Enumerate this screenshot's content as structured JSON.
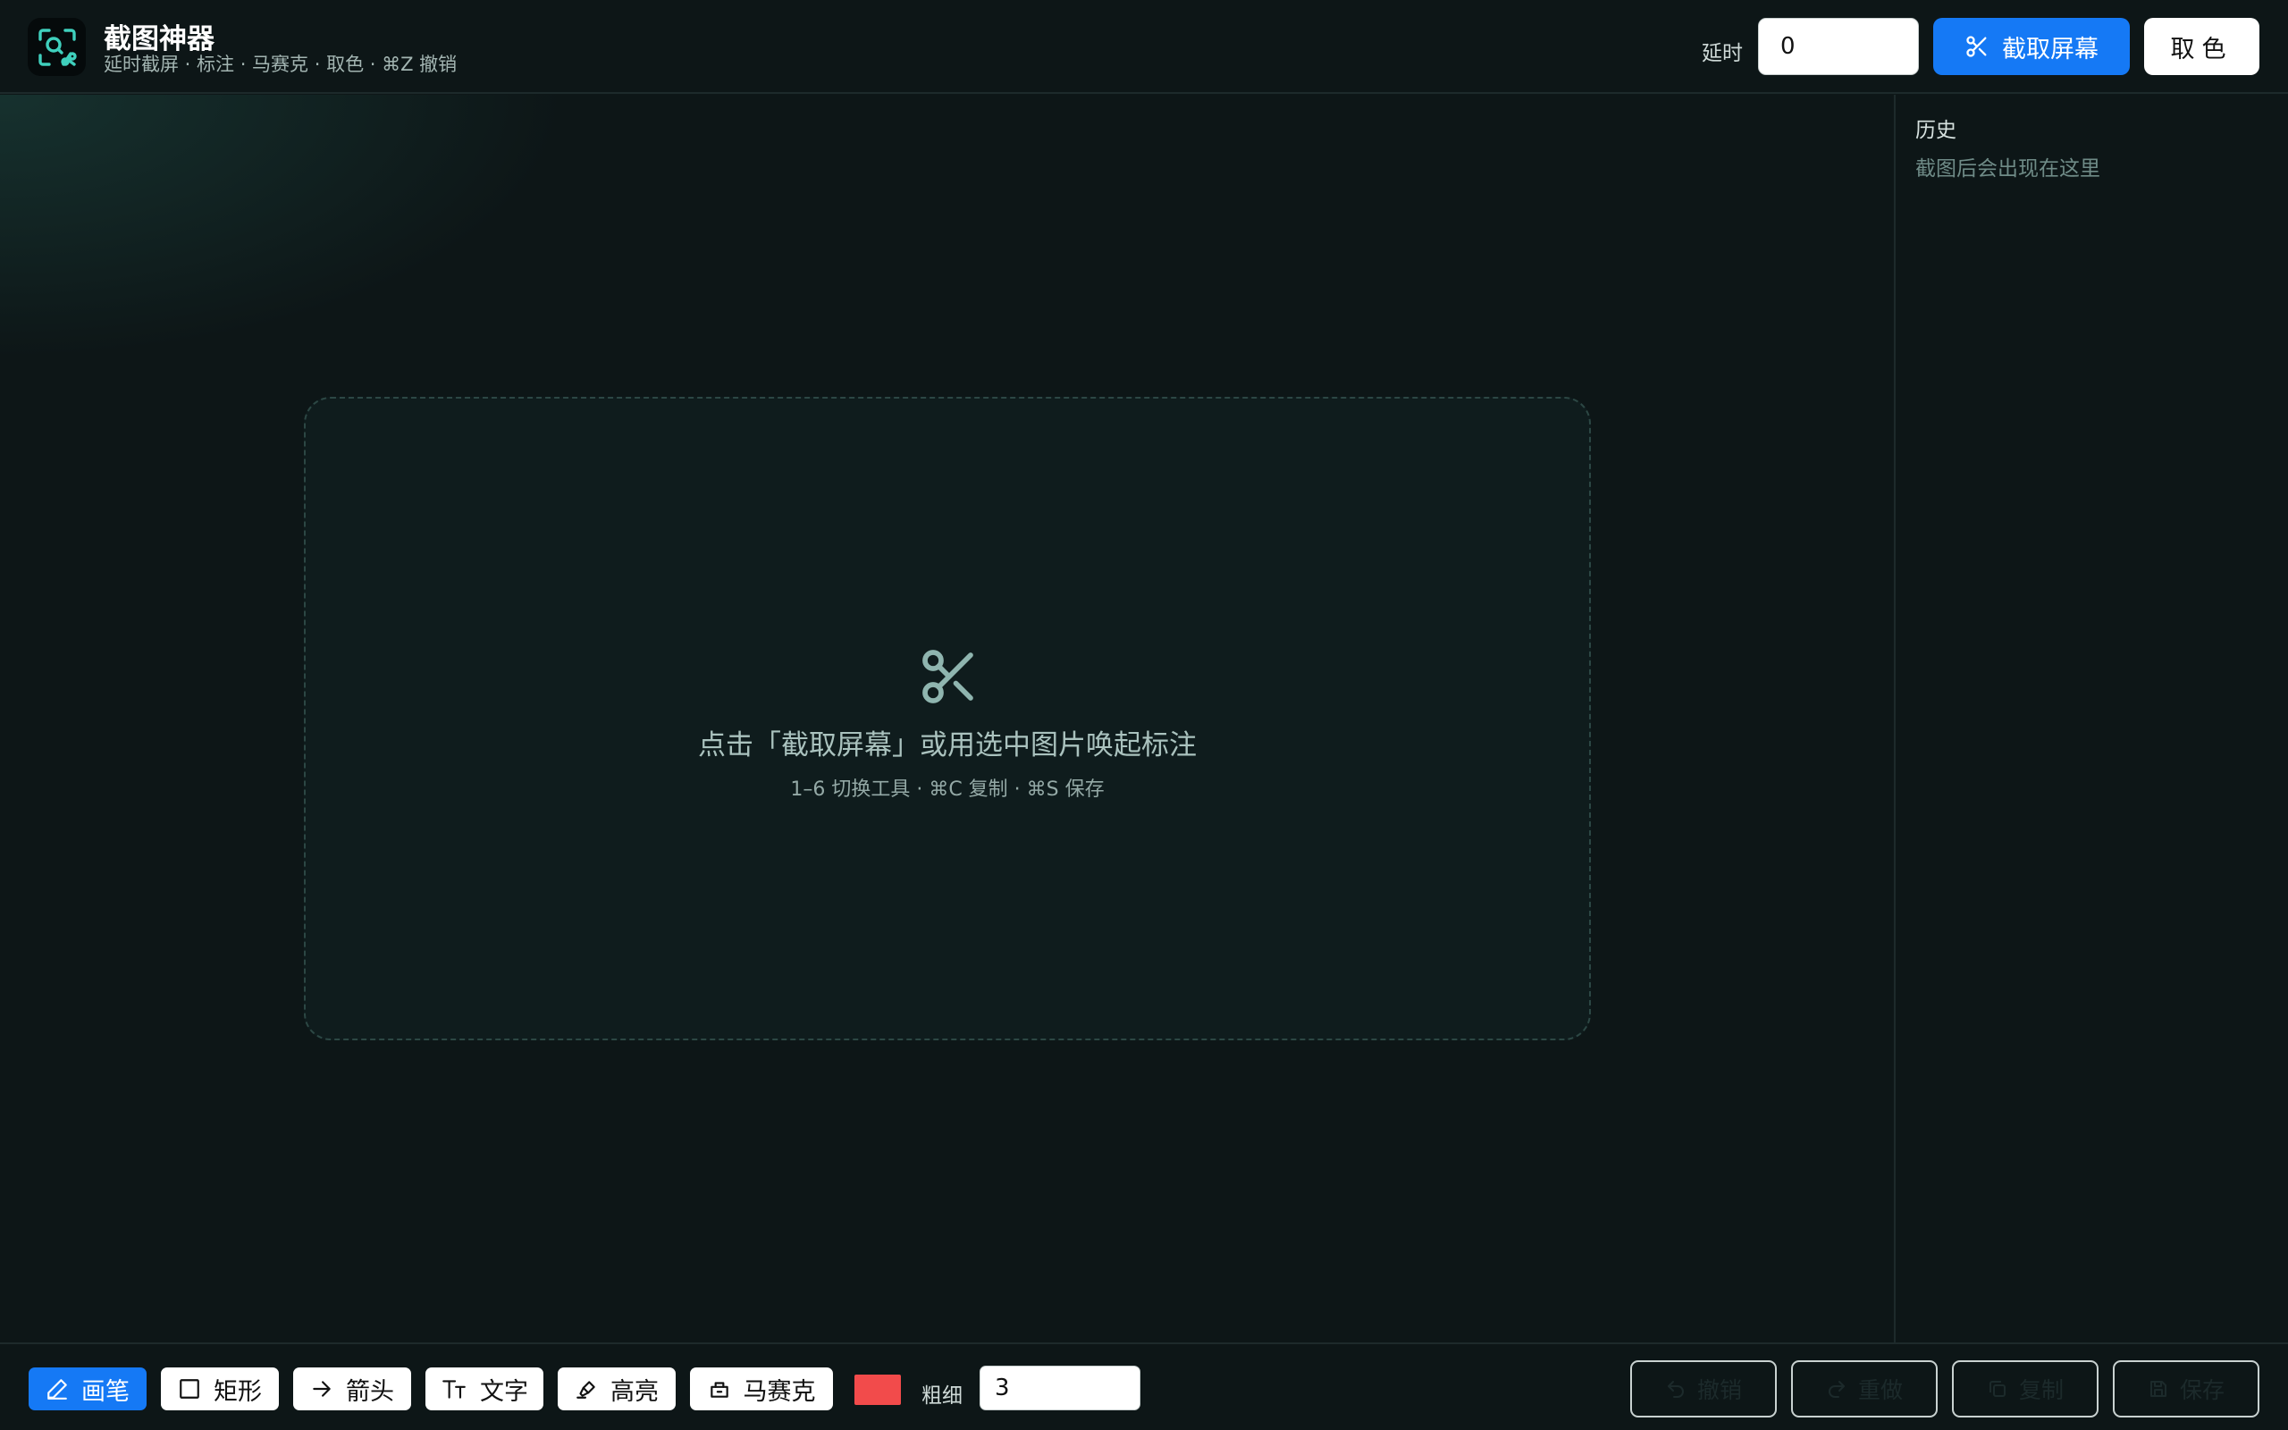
{
  "header": {
    "title": "截图神器",
    "subtitle": "延时截屏 · 标注 · 马赛克 · 取色 · ⌘Z 撤销",
    "delay_label": "延时",
    "delay_value": "0",
    "capture_label": "截取屏幕",
    "pick_color_label": "取色"
  },
  "canvas": {
    "empty_title": "点击「截取屏幕」或用选中图片唤起标注",
    "empty_hint": "1–6 切换工具 · ⌘C 复制 · ⌘S 保存"
  },
  "history": {
    "title": "历史",
    "empty_text": "截图后会出现在这里"
  },
  "toolbar": {
    "tools": [
      {
        "label": "画笔",
        "icon": "pen-icon",
        "active": true
      },
      {
        "label": "矩形",
        "icon": "rectangle-icon",
        "active": false
      },
      {
        "label": "箭头",
        "icon": "arrow-icon",
        "active": false
      },
      {
        "label": "文字",
        "icon": "text-icon",
        "active": false
      },
      {
        "label": "高亮",
        "icon": "highlighter-icon",
        "active": false
      },
      {
        "label": "马赛克",
        "icon": "mosaic-icon",
        "active": false
      }
    ],
    "color": "#f24b4b",
    "thickness_label": "粗细",
    "thickness_value": "3",
    "actions": [
      {
        "label": "撤销",
        "icon": "undo-icon"
      },
      {
        "label": "重做",
        "icon": "redo-icon"
      },
      {
        "label": "复制",
        "icon": "copy-icon"
      },
      {
        "label": "保存",
        "icon": "save-icon"
      }
    ]
  },
  "colors": {
    "accent": "#1579f5",
    "background": "#0d1617",
    "logo_accent": "#3fd0bd"
  }
}
